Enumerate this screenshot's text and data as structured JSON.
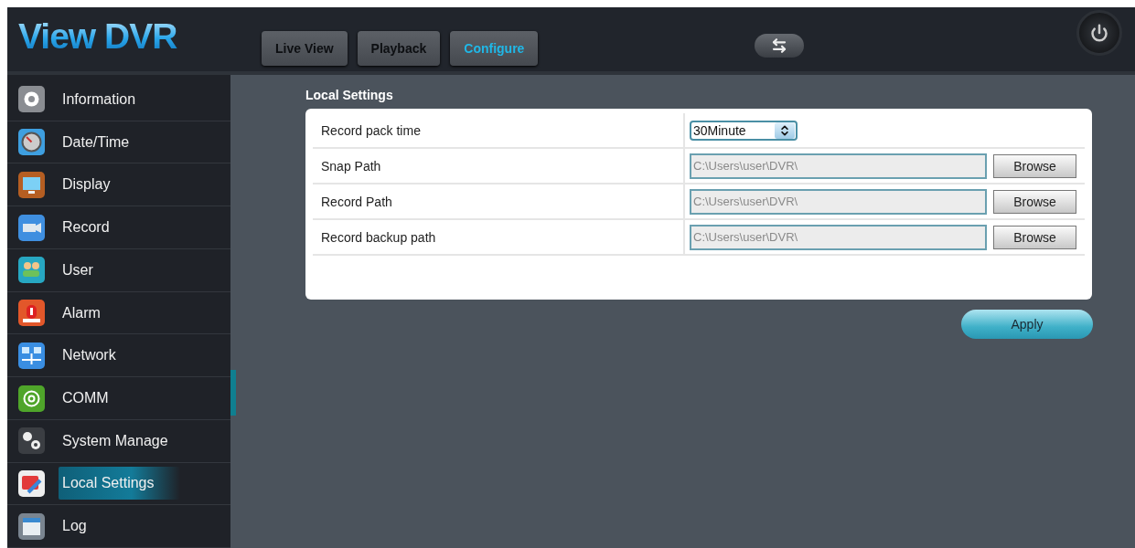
{
  "logo": "View DVR",
  "tabs": [
    {
      "label": "Live View",
      "selected": false
    },
    {
      "label": "Playback",
      "selected": false
    },
    {
      "label": "Configure",
      "selected": true
    }
  ],
  "sidebar": {
    "items": [
      {
        "label": "Information",
        "selected": false
      },
      {
        "label": "Date/Time",
        "selected": false
      },
      {
        "label": "Display",
        "selected": false
      },
      {
        "label": "Record",
        "selected": false
      },
      {
        "label": "User",
        "selected": false
      },
      {
        "label": "Alarm",
        "selected": false
      },
      {
        "label": "Network",
        "selected": false
      },
      {
        "label": "COMM",
        "selected": false
      },
      {
        "label": "System Manage",
        "selected": false
      },
      {
        "label": "Local Settings",
        "selected": true
      },
      {
        "label": "Log",
        "selected": false
      }
    ]
  },
  "content": {
    "title": "Local Settings",
    "rows": [
      {
        "kind": "select",
        "label": "Record pack time",
        "value": "30Minute"
      },
      {
        "kind": "path",
        "label": "Snap Path",
        "value": "C:\\Users\\user\\DVR\\",
        "disabled": true,
        "button": "Browse"
      },
      {
        "kind": "path",
        "label": "Record Path",
        "value": "C:\\Users\\user\\DVR\\",
        "disabled": true,
        "button": "Browse"
      },
      {
        "kind": "path",
        "label": "Record backup path",
        "value": "C:\\Users\\user\\DVR\\",
        "disabled": true,
        "button": "Browse"
      }
    ],
    "apply_button": "Apply"
  }
}
